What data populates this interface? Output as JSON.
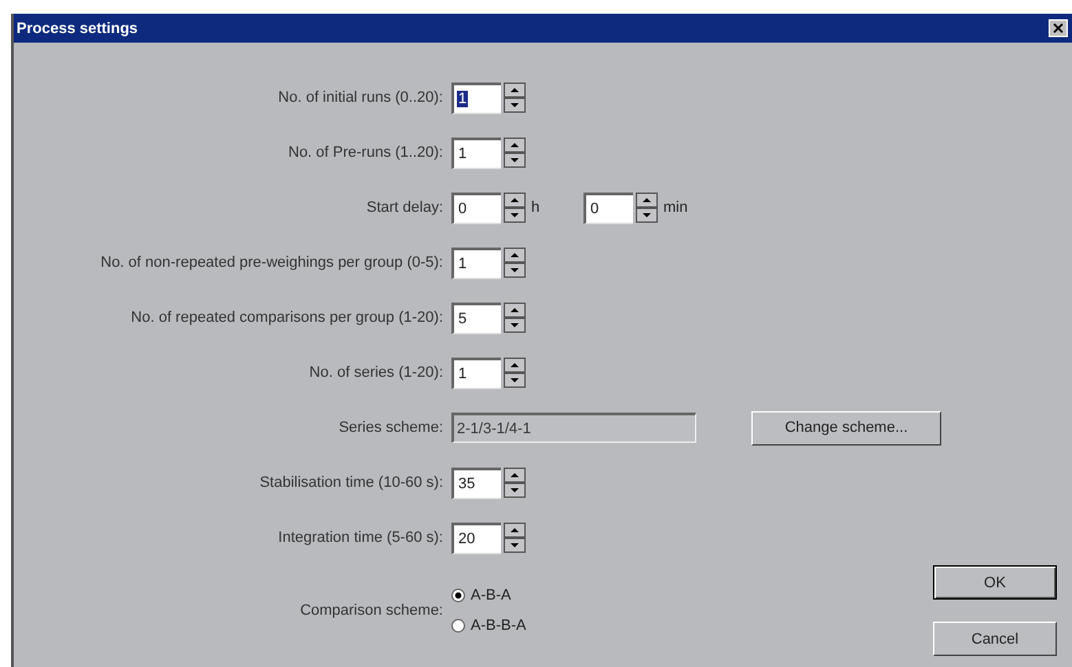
{
  "window": {
    "title": "Process settings"
  },
  "rows": [
    {
      "kind": "spin",
      "label": "No. of initial runs (0..20):",
      "value": "1",
      "focused": true
    },
    {
      "kind": "spin",
      "label": "No. of Pre-runs (1..20):",
      "value": "1",
      "focused": false
    },
    {
      "kind": "delay",
      "label": "Start delay:",
      "spinners": [
        {
          "value": "0",
          "unit": "h"
        },
        {
          "value": "0",
          "unit": "min"
        }
      ]
    },
    {
      "kind": "spin",
      "label": "No. of non-repeated pre-weighings per group (0-5):",
      "value": "1",
      "focused": false
    },
    {
      "kind": "spin",
      "label": "No. of repeated comparisons per group (1-20):",
      "value": "5",
      "focused": false
    },
    {
      "kind": "spin",
      "label": "No. of series (1-20):",
      "value": "1",
      "focused": false
    },
    {
      "kind": "scheme",
      "label": "Series scheme:",
      "value": "2-1/3-1/4-1",
      "button": "Change scheme..."
    },
    {
      "kind": "spin",
      "label": "Stabilisation time (10-60 s):",
      "value": "35",
      "focused": false
    },
    {
      "kind": "spin",
      "label": "Integration time (5-60 s):",
      "value": "20",
      "focused": false
    },
    {
      "kind": "radio",
      "label": "Comparison scheme:",
      "options": [
        {
          "label": "A-B-A",
          "selected": true
        },
        {
          "label": "A-B-B-A",
          "selected": false
        }
      ]
    }
  ],
  "buttons": [
    {
      "label": "OK",
      "default": true
    },
    {
      "label": "Cancel",
      "default": false
    }
  ]
}
